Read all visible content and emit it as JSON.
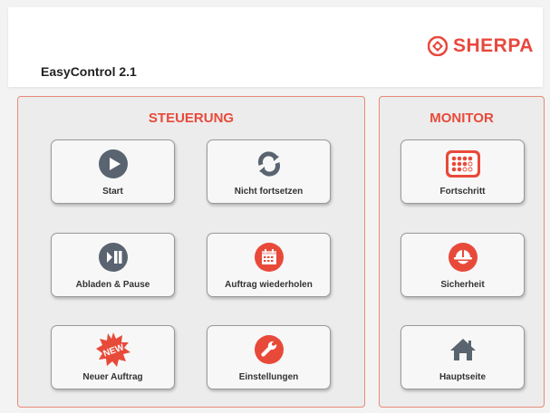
{
  "header": {
    "app_title": "EasyControl 2.1",
    "logo_text": "SHERPA"
  },
  "colors": {
    "accent": "#e84a3a",
    "icon_dark": "#5a6470",
    "border": "#e88a7a"
  },
  "steuerung": {
    "title": "STEUERUNG",
    "buttons": [
      {
        "label": "Start",
        "icon": "play-icon"
      },
      {
        "label": "Nicht fortsetzen",
        "icon": "refresh-icon"
      },
      {
        "label": "Abladen & Pause",
        "icon": "pause-icon"
      },
      {
        "label": "Auftrag wiederholen",
        "icon": "calendar-icon"
      },
      {
        "label": "Neuer Auftrag",
        "icon": "new-badge-icon"
      },
      {
        "label": "Einstellungen",
        "icon": "wrench-icon"
      }
    ]
  },
  "monitor": {
    "title": "MONITOR",
    "buttons": [
      {
        "label": "Fortschritt",
        "icon": "progress-grid-icon"
      },
      {
        "label": "Sicherheit",
        "icon": "safety-helmet-icon"
      },
      {
        "label": "Hauptseite",
        "icon": "home-icon"
      }
    ]
  }
}
